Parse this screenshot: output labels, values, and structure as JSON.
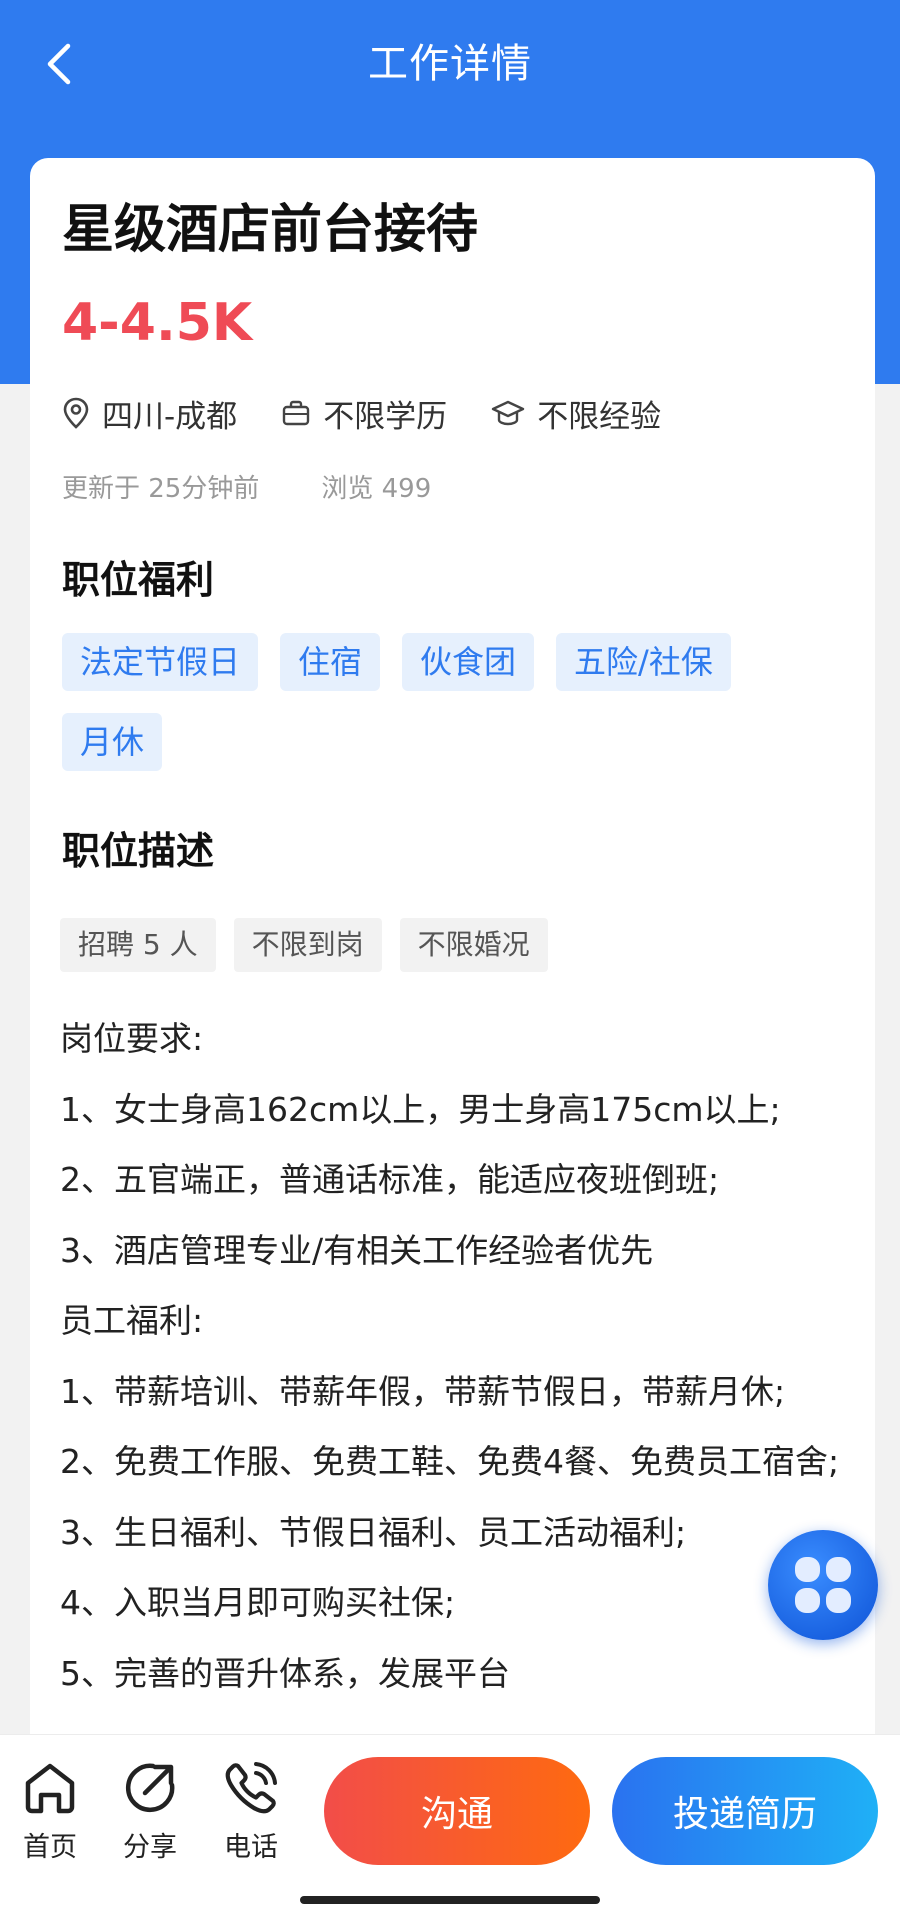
{
  "header": {
    "title": "工作详情"
  },
  "job": {
    "title": "星级酒店前台接待",
    "salary": "4-4.5K",
    "location": "四川-成都",
    "education": "不限学历",
    "experience": "不限经验",
    "updated": "更新于 25分钟前",
    "views": "浏览 499"
  },
  "benefits": {
    "title": "职位福利",
    "tags": [
      "法定节假日",
      "住宿",
      "伙食团",
      "五险/社保",
      "月休"
    ]
  },
  "description": {
    "title": "职位描述",
    "tags": [
      "招聘 5 人",
      "不限到岗",
      "不限婚况"
    ],
    "lines": [
      "岗位要求:",
      "1、女士身高162cm以上，男士身高175cm以上;",
      "2、五官端正，普通话标准，能适应夜班倒班;",
      "3、酒店管理专业/有相关工作经验者优先",
      "员工福利:",
      "1、带薪培训、带薪年假，带薪节假日，带薪月休;",
      "2、免费工作服、免费工鞋、免费4餐、免费员工宿舍;",
      "3、生日福利、节假日福利、员工活动福利;",
      "4、入职当月即可购买社保;",
      "5、完善的晋升体系，发展平台"
    ]
  },
  "bottom_nav": {
    "home": "首页",
    "share": "分享",
    "phone": "电话",
    "chat": "沟通",
    "apply": "投递简历"
  },
  "colors": {
    "primary": "#2f7bef",
    "salary": "#ef4b56",
    "tag_bg": "#e6f0fd",
    "chat_gradient": [
      "#f24d49",
      "#fe6a10"
    ],
    "apply_gradient": [
      "#2a72f0",
      "#1fb0f6"
    ]
  }
}
